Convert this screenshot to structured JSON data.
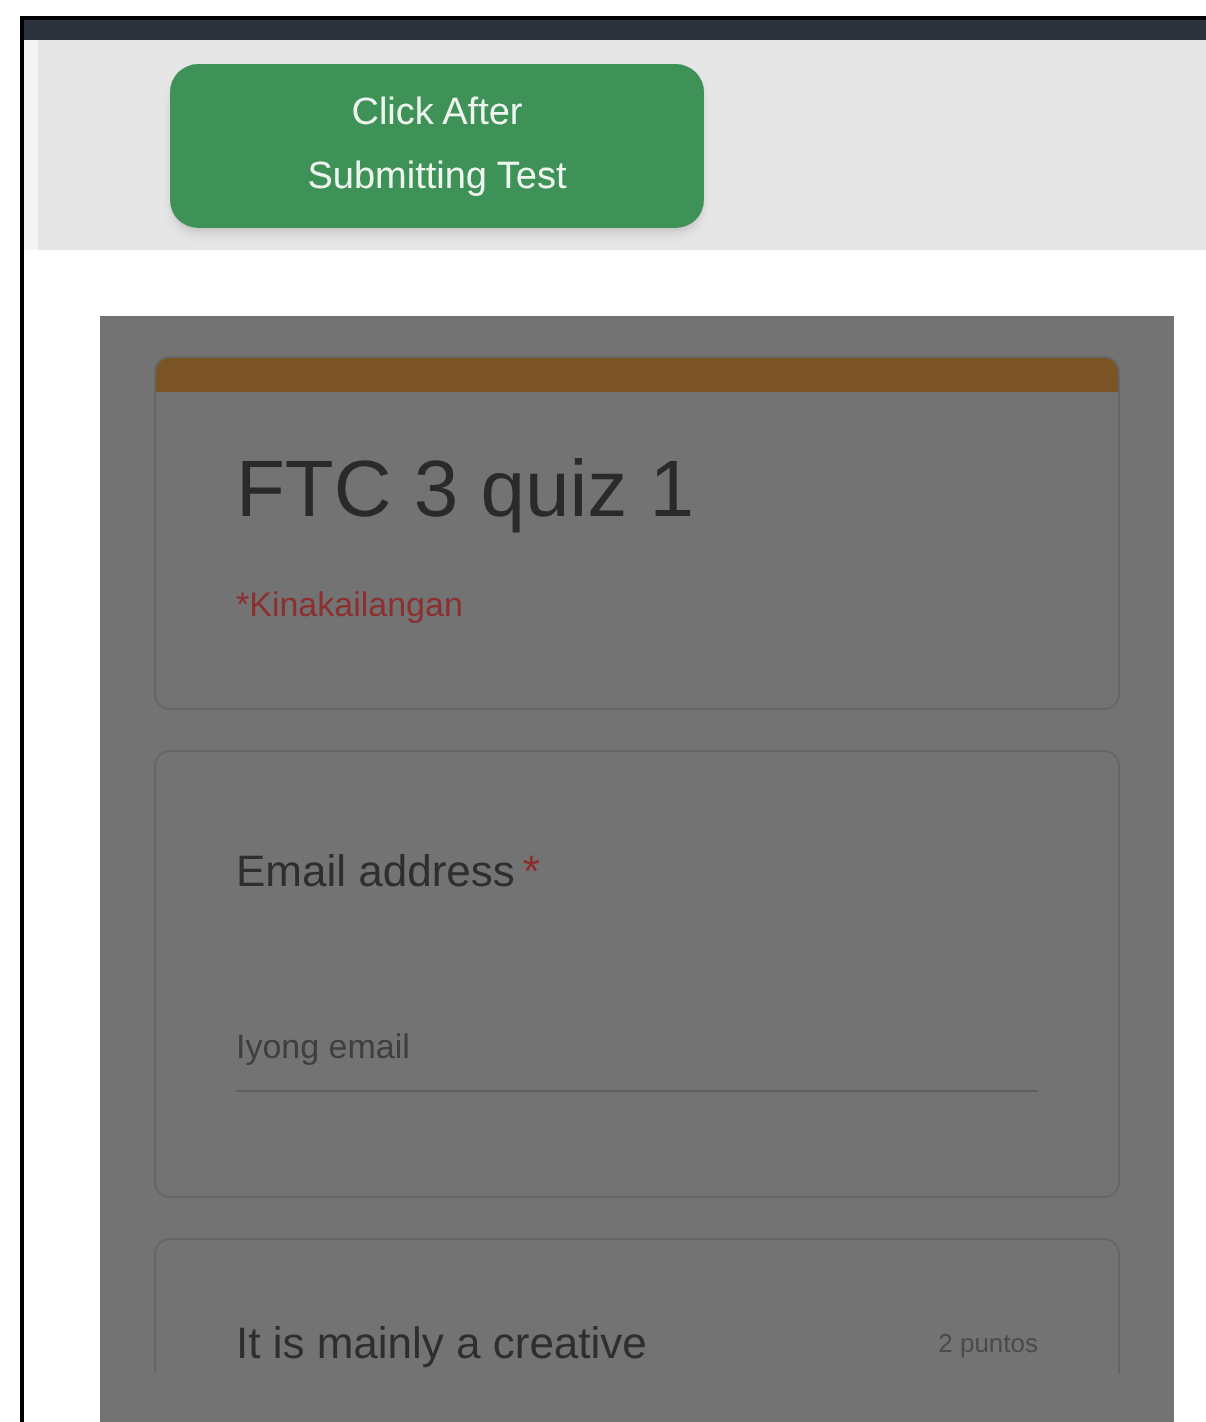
{
  "action_button": {
    "label": "Click After Submitting Test"
  },
  "form": {
    "title": "FTC 3 quiz 1",
    "required_note": "*Kinakailangan",
    "questions": [
      {
        "kind": "text_input",
        "label": "Email address",
        "required": true,
        "required_mark": "*",
        "placeholder": "Iyong email"
      },
      {
        "kind": "question",
        "label": "It is mainly a creative",
        "points": "2 puntos"
      }
    ]
  }
}
